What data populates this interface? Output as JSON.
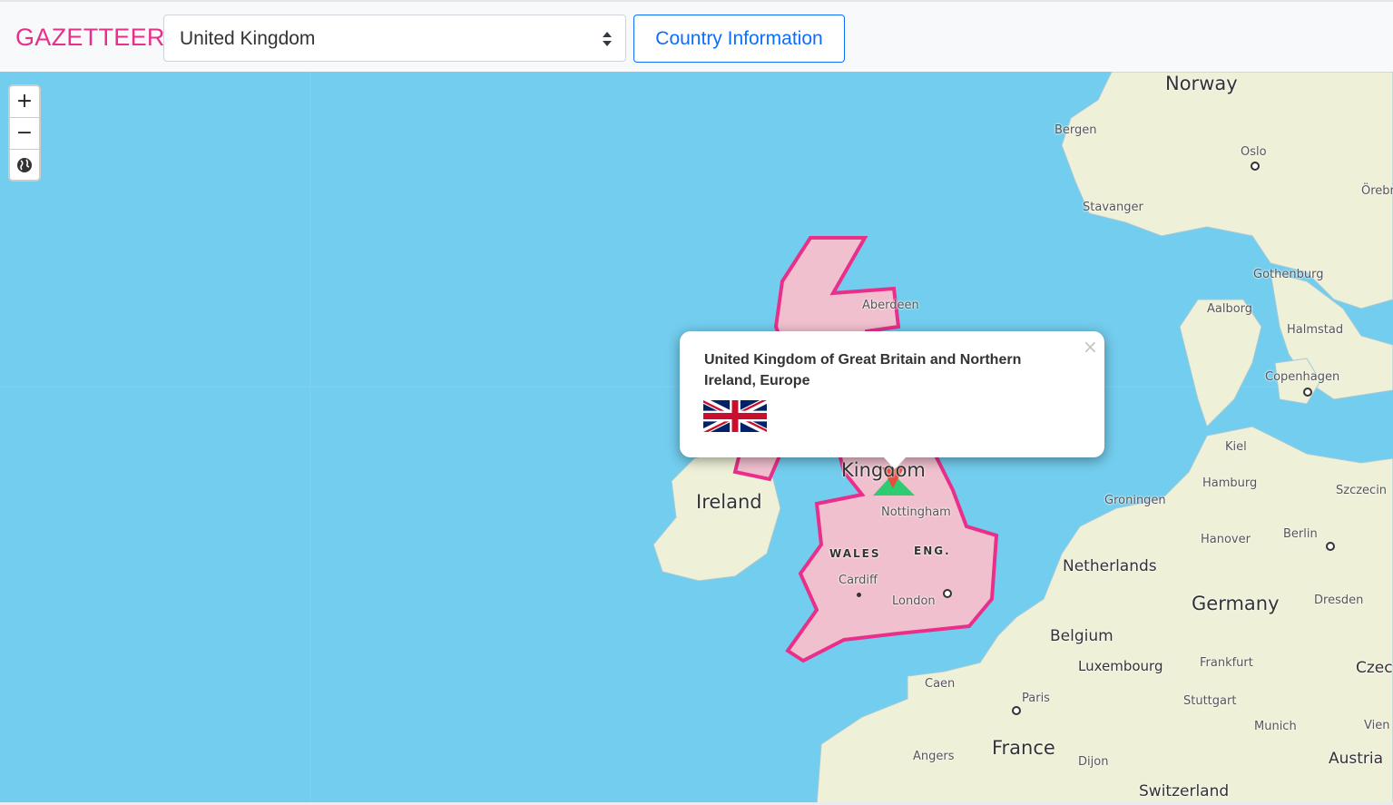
{
  "navbar": {
    "brand": "GAZETTEER",
    "country_select": {
      "value": "United Kingdom"
    },
    "info_button": "Country Information"
  },
  "map_controls": {
    "zoom_in": "+",
    "zoom_out": "−",
    "globe_icon": "globe-icon"
  },
  "popup": {
    "close": "×",
    "title": "United Kingdom of Great Britain and Northern Ireland, Europe",
    "flag": "union-jack-flag"
  },
  "map_labels": {
    "norway": "Norway",
    "bergen": "Bergen",
    "oslo": "Oslo",
    "orebro": "Örebr",
    "stavanger": "Stavanger",
    "gothenburg": "Gothenburg",
    "aalborg": "Aalborg",
    "halmstad": "Halmstad",
    "copenhagen": "Copenhagen",
    "aberdeen": "Aberdeen",
    "kiel": "Kiel",
    "hamburg": "Hamburg",
    "szczecin": "Szczecin",
    "groningen": "Groningen",
    "hanover": "Hanover",
    "berlin": "Berlin",
    "netherlands": "Netherlands",
    "germany": "Germany",
    "dresden": "Dresden",
    "ireland": "Ireland",
    "kingdom": "Kingdom",
    "nottingham": "Nottingham",
    "wales": "WALES",
    "eng": "ENG.",
    "cardiff": "Cardiff",
    "london": "London",
    "belgium": "Belgium",
    "luxembourg": "Luxembourg",
    "frankfurt": "Frankfurt",
    "czech": "Czec",
    "caen": "Caen",
    "paris": "Paris",
    "stuttgart": "Stuttgart",
    "munich": "Munich",
    "vienna": "Vien",
    "france": "France",
    "angers": "Angers",
    "dijon": "Dijon",
    "austria": "Austria",
    "switzerland": "Switzerland"
  },
  "colors": {
    "brand": "#e8308a",
    "sea": "#73cdee",
    "land": "#eef0d8",
    "uk_fill": "#f1c0cf",
    "uk_border": "#e8308a",
    "button_blue": "#0d6efd"
  }
}
